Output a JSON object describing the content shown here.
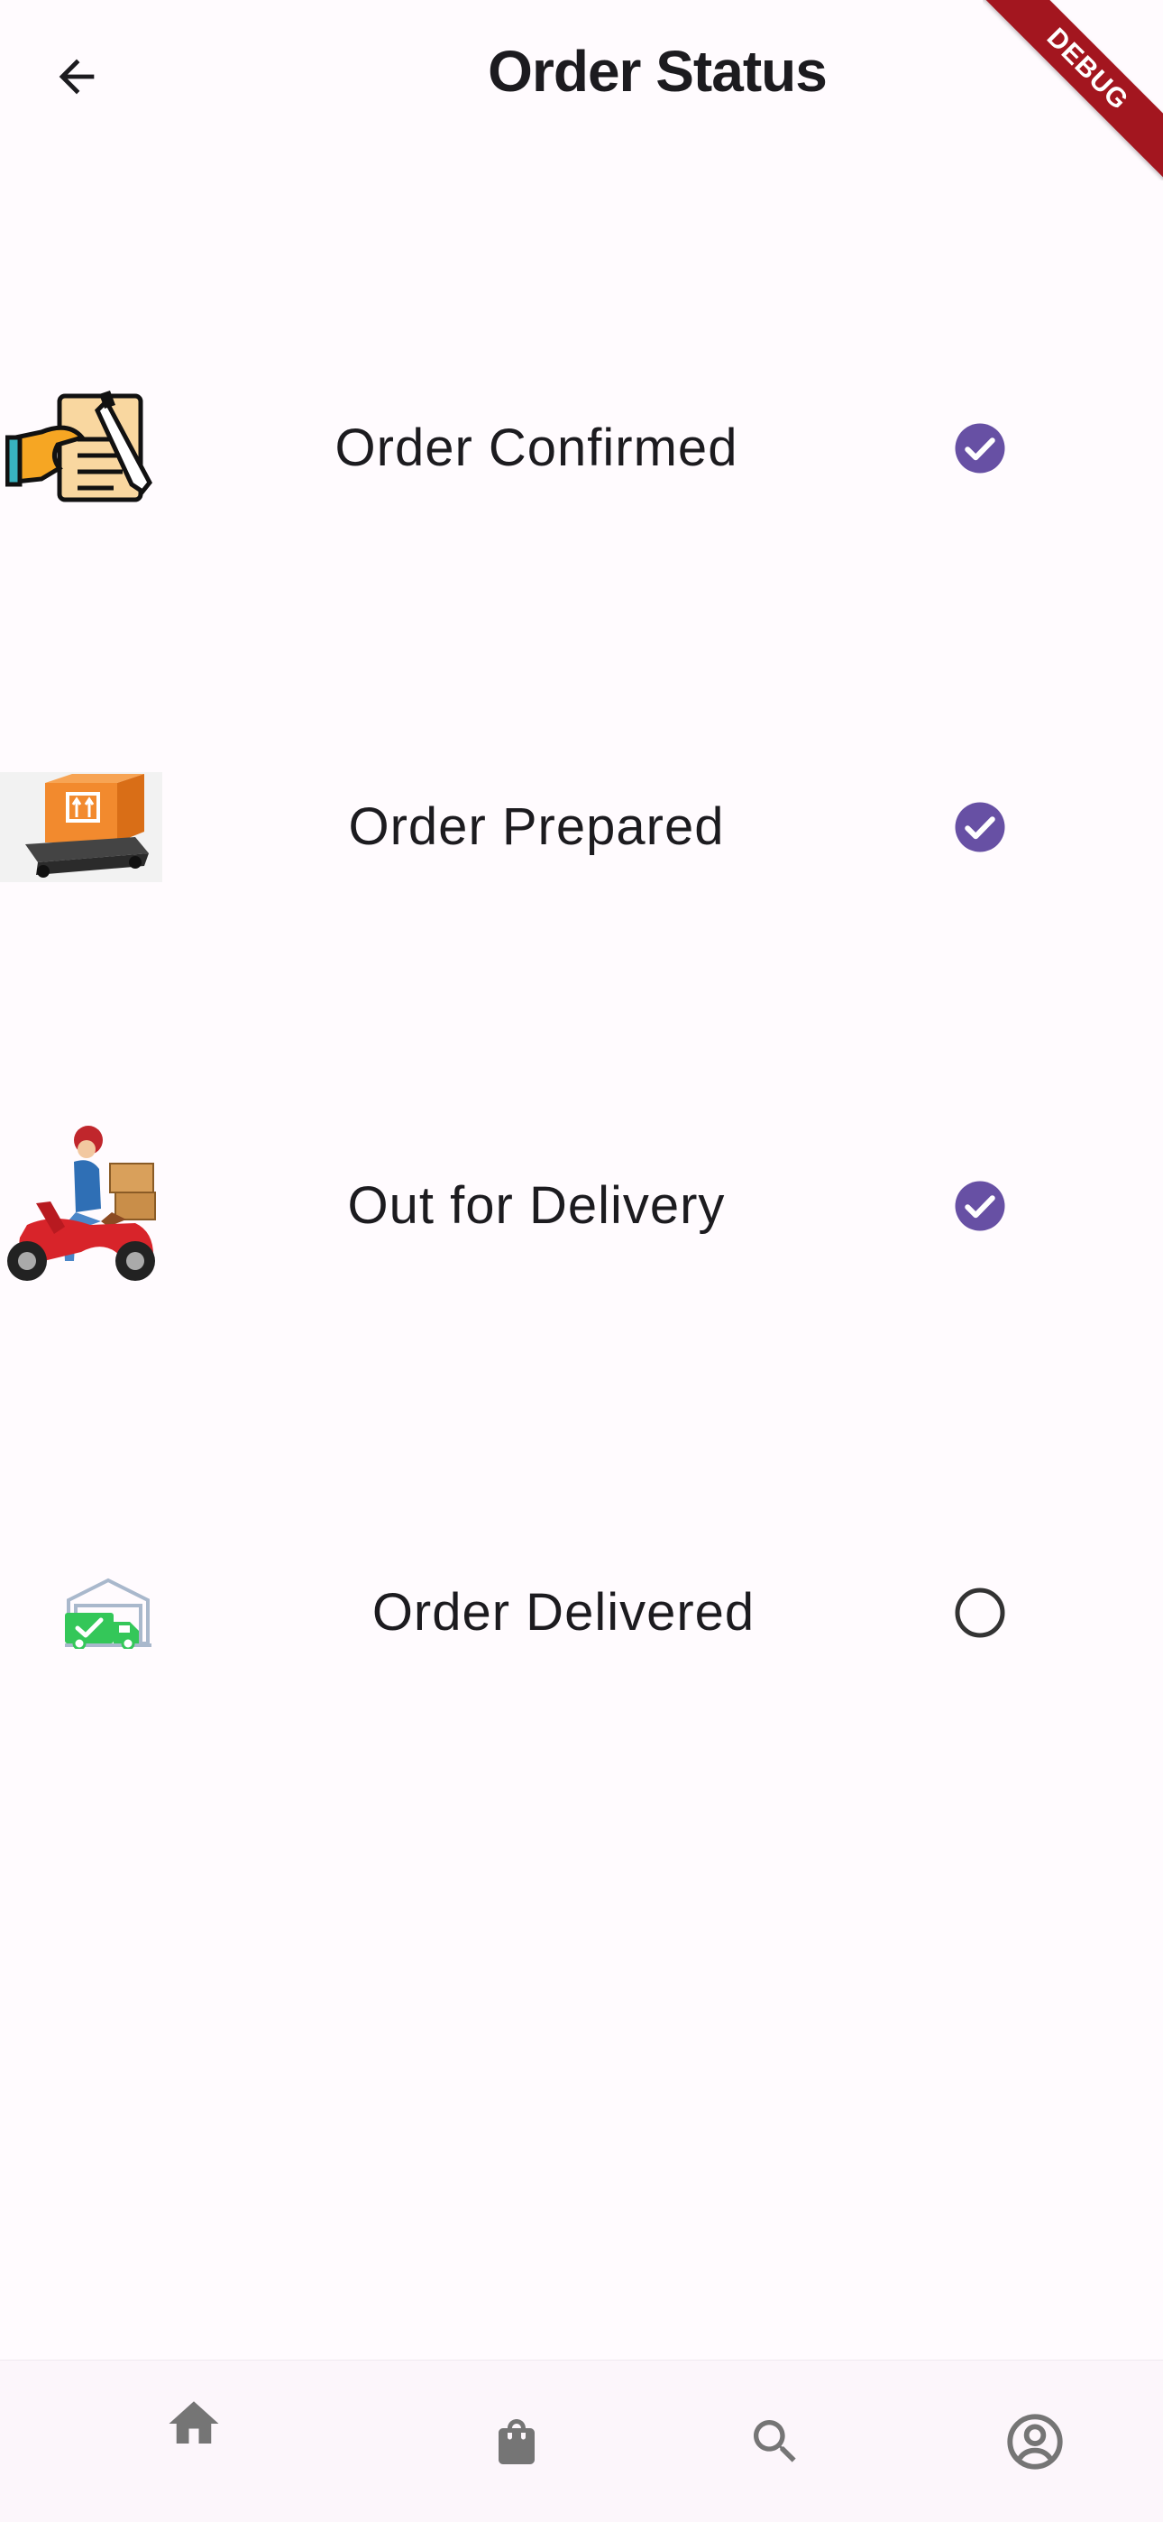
{
  "app_bar": {
    "title": "Order Status",
    "back_icon": "arrow-back-icon"
  },
  "debug_banner": {
    "text": "DEBUG",
    "color": "#a3161f"
  },
  "accent_color": "#6750a4",
  "statuses": [
    {
      "label": "Order Confirmed",
      "icon": "signed-document-icon",
      "completed": true
    },
    {
      "label": "Order Prepared",
      "icon": "package-on-pallet-icon",
      "completed": true
    },
    {
      "label": "Out for Delivery",
      "icon": "delivery-scooter-icon",
      "completed": true
    },
    {
      "label": "Order Delivered",
      "icon": "delivered-truck-icon",
      "completed": false
    }
  ],
  "bottom_nav": [
    {
      "icon": "home-icon",
      "active": true
    },
    {
      "icon": "shopping-bag-icon",
      "active": false
    },
    {
      "icon": "search-icon",
      "active": false
    },
    {
      "icon": "account-circle-icon",
      "active": false
    }
  ]
}
